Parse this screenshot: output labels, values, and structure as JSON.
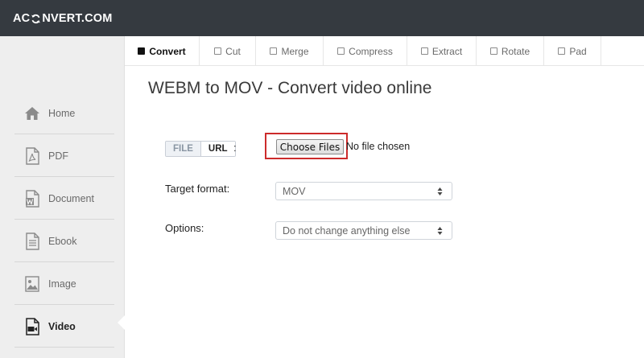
{
  "brand": {
    "part1": "AC",
    "part2": "NVERT.COM"
  },
  "sidebar": {
    "items": [
      {
        "label": "Home",
        "icon": "home-icon",
        "active": false
      },
      {
        "label": "PDF",
        "icon": "pdf-file-icon",
        "active": false
      },
      {
        "label": "Document",
        "icon": "word-document-icon",
        "active": false
      },
      {
        "label": "Ebook",
        "icon": "ebook-icon",
        "active": false
      },
      {
        "label": "Image",
        "icon": "image-icon",
        "active": false
      },
      {
        "label": "Video",
        "icon": "video-camera-icon",
        "active": true
      }
    ]
  },
  "tabs": [
    {
      "label": "Convert",
      "active": true
    },
    {
      "label": "Cut",
      "active": false
    },
    {
      "label": "Merge",
      "active": false
    },
    {
      "label": "Compress",
      "active": false
    },
    {
      "label": "Extract",
      "active": false
    },
    {
      "label": "Rotate",
      "active": false
    },
    {
      "label": "Pad",
      "active": false
    }
  ],
  "main": {
    "title": "WEBM to MOV - Convert video online",
    "source_toggle": {
      "file": "FILE",
      "url": "URL",
      "separator": ":"
    },
    "file_input": {
      "button": "Choose Files",
      "status": "No file chosen"
    },
    "target_format": {
      "label": "Target format:",
      "value": "MOV"
    },
    "options": {
      "label": "Options:",
      "value": "Do not change anything else"
    }
  },
  "colors": {
    "topbar": "#353a40",
    "highlight": "#cc2b2b",
    "sidebar_bg": "#eeeeee"
  }
}
